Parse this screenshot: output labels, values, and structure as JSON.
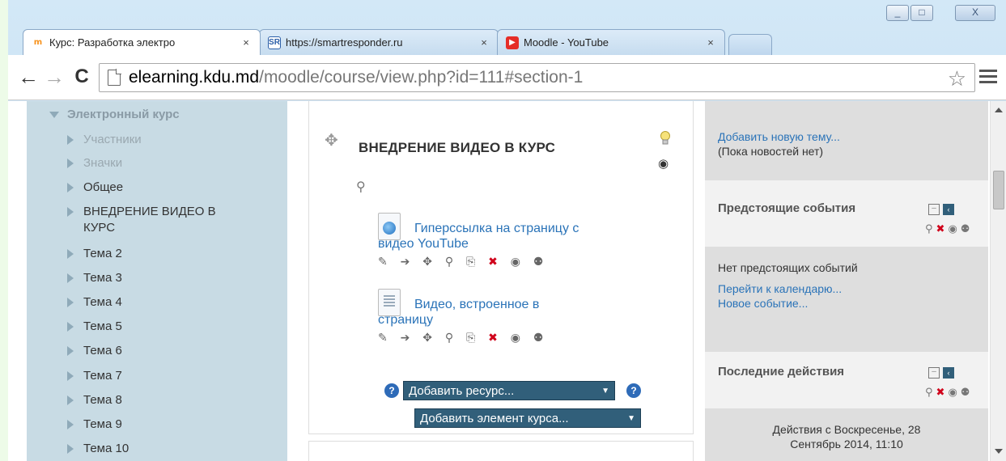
{
  "window": {
    "min_label": "_",
    "max_label": "□",
    "close_label": "X"
  },
  "tabs": [
    {
      "label": "Курс: Разработка электро",
      "close": "×",
      "favicon": "moodle-icon"
    },
    {
      "label": "https://smartresponder.ru",
      "close": "×",
      "favicon": "smartresponder-icon",
      "fav_text": "SR"
    },
    {
      "label": "Moodle - YouTube",
      "close": "×",
      "favicon": "youtube-icon"
    }
  ],
  "toolbar": {
    "back": "←",
    "forward": "→",
    "reload": "C",
    "url_host": "elearning.kdu.md",
    "url_path": "/moodle/course/view.php?id=111#section-1",
    "star": "☆"
  },
  "nav": {
    "heading": "Электронный курс",
    "items": [
      {
        "label": "Участники",
        "muted": true
      },
      {
        "label": "Значки",
        "muted": true
      },
      {
        "label": "Общее"
      },
      {
        "label": "ВНЕДРЕНИЕ ВИДЕО В"
      },
      {
        "label": "КУРС"
      },
      {
        "label": "Тема 2"
      },
      {
        "label": "Тема 3"
      },
      {
        "label": "Тема 4"
      },
      {
        "label": "Тема 5"
      },
      {
        "label": "Тема 6"
      },
      {
        "label": "Тема 7"
      },
      {
        "label": "Тема 8"
      },
      {
        "label": "Тема 9"
      },
      {
        "label": "Тема 10"
      }
    ]
  },
  "section": {
    "title": "ВНЕДРЕНИЕ ВИДЕО В КУРС",
    "activities": [
      {
        "line1": "Гиперссылка на страницу с",
        "line2": "видео YouTube",
        "icon": "url-resource-icon"
      },
      {
        "line1": "Видео, встроенное в",
        "line2": "страницу",
        "icon": "page-resource-icon"
      }
    ],
    "edit_icons": "✎ ➔ ✥ ⚲ ⎘",
    "add_resource": "Добавить ресурс...",
    "add_activity": "Добавить элемент курса...",
    "help": "?"
  },
  "blocks": {
    "news": {
      "add_topic": "Добавить новую тему...",
      "empty": "(Пока новостей нет)"
    },
    "upcoming": {
      "title": "Предстоящие события",
      "empty": "Нет предстоящих событий",
      "calendar_link": "Перейти к календарю...",
      "new_event": "Новое событие..."
    },
    "recent": {
      "title": "Последние действия",
      "since_line1": "Действия с Воскресенье, 28",
      "since_line2": "Сентябрь 2014, 11:10"
    }
  },
  "colors": {
    "nav_bg": "#c8dbe4",
    "link": "#2a73b8",
    "select_bg": "#315f7a",
    "help_icon": "#2e6bb8",
    "delete_icon": "#d0021b"
  }
}
